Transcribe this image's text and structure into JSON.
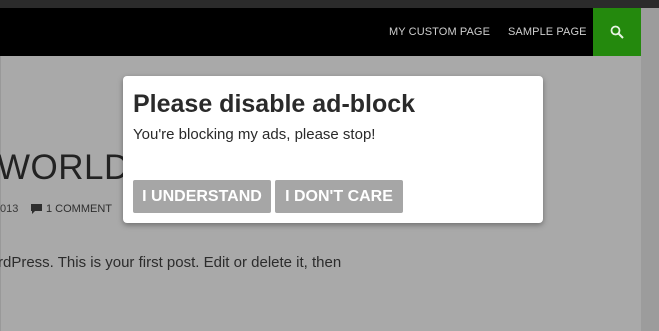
{
  "nav": {
    "items": [
      {
        "label": "MY CUSTOM PAGE"
      },
      {
        "label": "SAMPLE PAGE"
      }
    ],
    "search_icon": "search-icon",
    "accent": "#24890d"
  },
  "post": {
    "title": "WORLD!",
    "date_fragment": "013",
    "comments_icon": "comment-bubble-icon",
    "comments": "1 COMMENT",
    "excerpt": "rdPress. This is your first post. Edit or delete it, then"
  },
  "modal": {
    "title": "Please disable ad-block",
    "message": "You're blocking my ads, please stop!",
    "buttons": {
      "understand": "I UNDERSTAND",
      "dont_care": "I DON'T CARE"
    }
  }
}
